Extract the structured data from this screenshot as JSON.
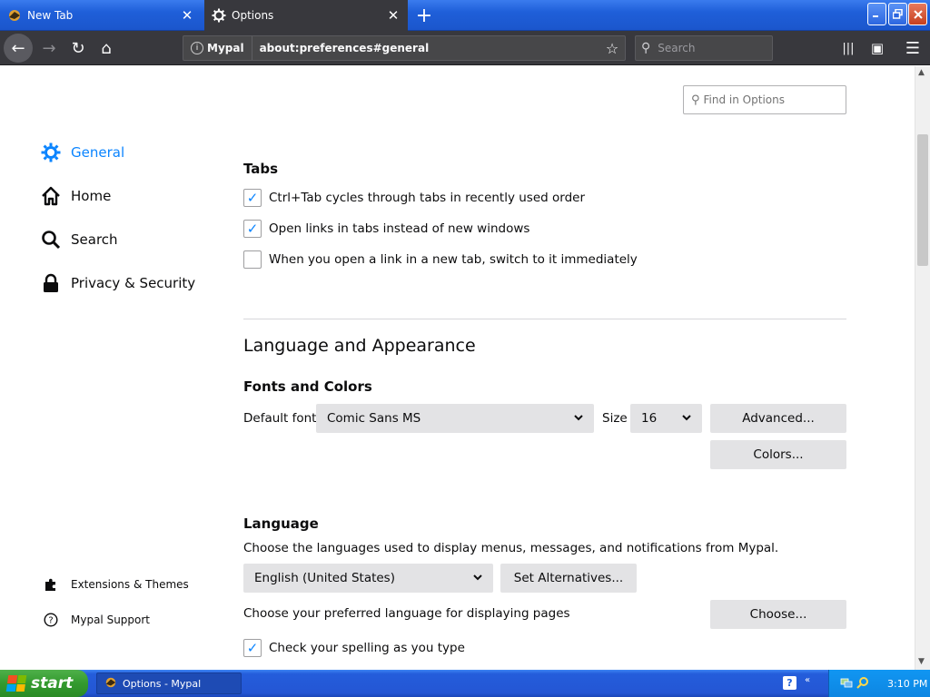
{
  "tabs": [
    {
      "label": "New Tab",
      "active": false
    },
    {
      "label": "Options",
      "active": true
    }
  ],
  "icons": {
    "new_tab": "+",
    "close": "✕",
    "back": "←",
    "forward": "→",
    "reload": "↻",
    "home": "⌂",
    "star": "☆",
    "search": "⚲",
    "library": "|||",
    "sidebar": "▣",
    "menu": "☰"
  },
  "urlbar": {
    "identity": "Mypal",
    "url": "about:preferences#general"
  },
  "searchbar": {
    "placeholder": "Search"
  },
  "find": {
    "placeholder": "Find in Options"
  },
  "categories": [
    {
      "label": "General",
      "icon": "gear-icon",
      "selected": true
    },
    {
      "label": "Home",
      "icon": "home-icon",
      "selected": false
    },
    {
      "label": "Search",
      "icon": "search-icon",
      "selected": false
    },
    {
      "label": "Privacy & Security",
      "icon": "lock-icon",
      "selected": false
    }
  ],
  "footer_links": [
    {
      "label": "Extensions & Themes",
      "icon": "puzzle-icon"
    },
    {
      "label": "Mypal Support",
      "icon": "help-icon"
    }
  ],
  "tabs_section": {
    "title": "Tabs",
    "options": [
      {
        "label": "Ctrl+Tab cycles through tabs in recently used order",
        "checked": true
      },
      {
        "label": "Open links in tabs instead of new windows",
        "checked": true
      },
      {
        "label": "When you open a link in a new tab, switch to it immediately",
        "checked": false
      }
    ]
  },
  "language_appearance": {
    "title": "Language and Appearance",
    "fonts": {
      "title": "Fonts and Colors",
      "default_font_label": "Default font",
      "default_font_value": "Comic Sans MS",
      "size_label": "Size",
      "size_value": "16",
      "advanced_button": "Advanced...",
      "colors_button": "Colors..."
    },
    "language": {
      "title": "Language",
      "description": "Choose the languages used to display menus, messages, and notifications from Mypal.",
      "selected": "English (United States)",
      "set_alternatives_button": "Set Alternatives...",
      "pages_label": "Choose your preferred language for displaying pages",
      "choose_button": "Choose...",
      "spellcheck_label": "Check your spelling as you type",
      "spellcheck_checked": true
    }
  },
  "taskbar": {
    "start_label": "start",
    "task_label": "Options - Mypal",
    "help_glyph": "?",
    "tray_arrow": "«",
    "clock": "3:10 PM"
  },
  "checkmark": "✓",
  "chevron": "⌄"
}
